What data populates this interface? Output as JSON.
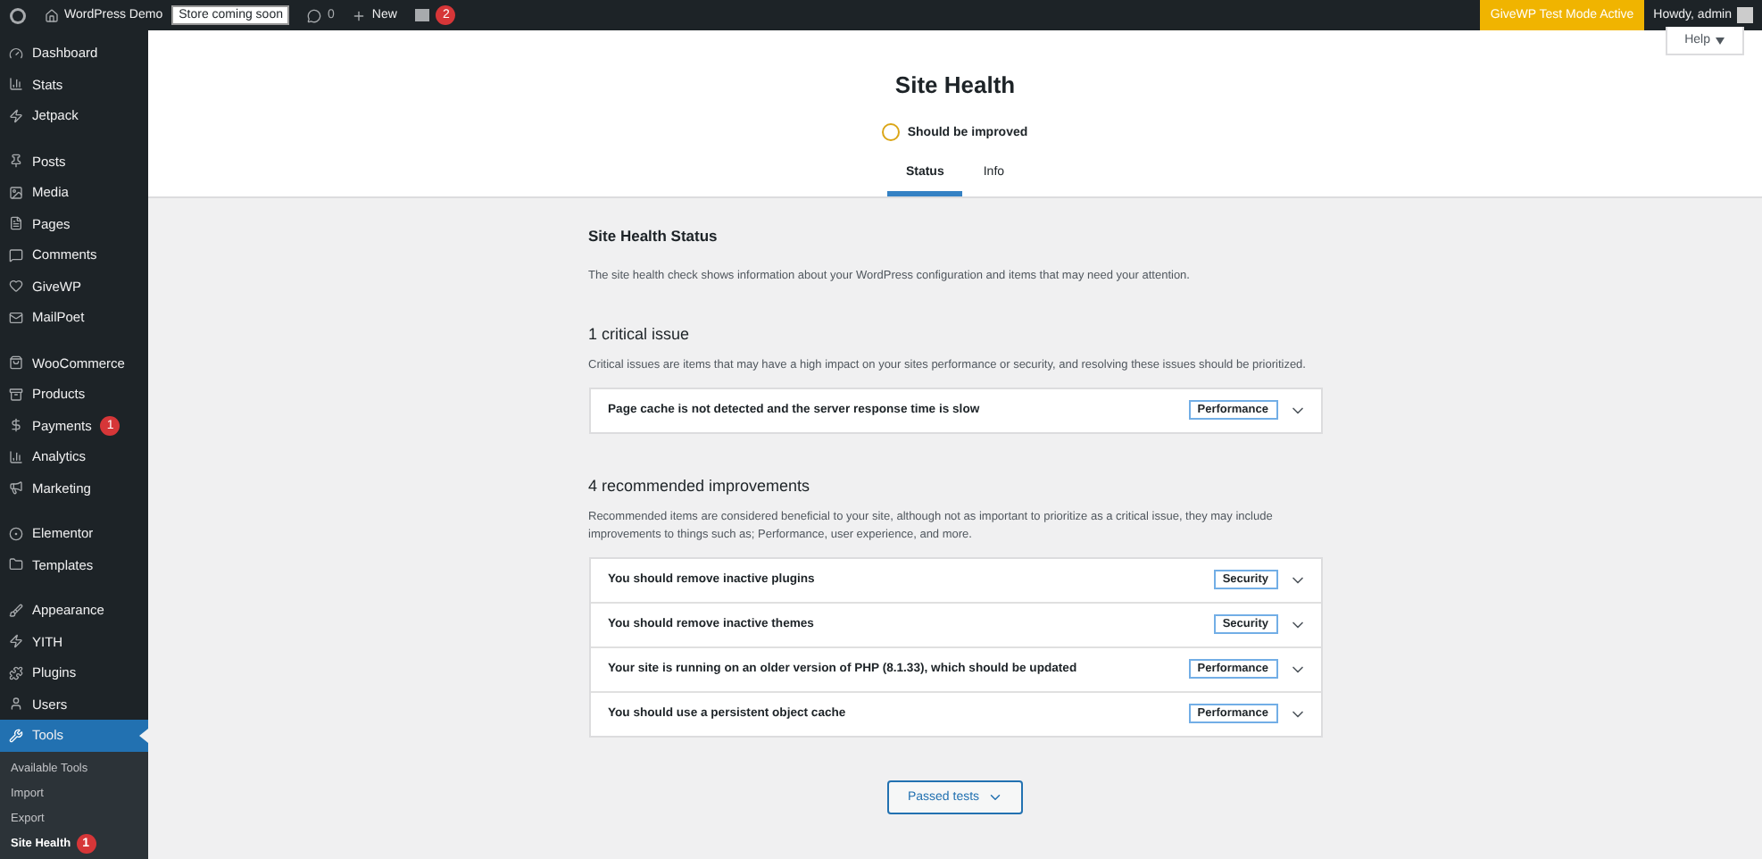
{
  "admin_bar": {
    "site_name": "WordPress Demo",
    "store_badge": "Store coming soon",
    "comments_count": "0",
    "new_label": "New",
    "notifications_count": "2",
    "givewp_notice": "GiveWP Test Mode Active",
    "greeting": "Howdy, admin"
  },
  "sidebar": {
    "groups": [
      {
        "items": [
          {
            "label": "Dashboard",
            "selected": false
          },
          {
            "label": "Stats",
            "selected": false
          },
          {
            "label": "Jetpack",
            "selected": false
          }
        ]
      },
      {
        "items": [
          {
            "label": "Posts",
            "selected": false
          },
          {
            "label": "Media",
            "selected": false
          },
          {
            "label": "Pages",
            "selected": false
          },
          {
            "label": "Comments",
            "selected": false
          },
          {
            "label": "GiveWP",
            "selected": false
          },
          {
            "label": "MailPoet",
            "selected": false
          }
        ]
      },
      {
        "items": [
          {
            "label": "WooCommerce",
            "selected": false
          },
          {
            "label": "Products",
            "selected": false
          },
          {
            "label": "Payments",
            "selected": false,
            "badge": "1"
          },
          {
            "label": "Analytics",
            "selected": false
          },
          {
            "label": "Marketing",
            "selected": false
          }
        ]
      },
      {
        "items": [
          {
            "label": "Elementor",
            "selected": false
          },
          {
            "label": "Templates",
            "selected": false
          }
        ]
      },
      {
        "items": [
          {
            "label": "Appearance",
            "selected": false
          },
          {
            "label": "YITH",
            "selected": false
          },
          {
            "label": "Plugins",
            "selected": false
          },
          {
            "label": "Users",
            "selected": false
          },
          {
            "label": "Tools",
            "selected": true,
            "children": [
              {
                "label": "Available Tools",
                "selected": false
              },
              {
                "label": "Import",
                "selected": false
              },
              {
                "label": "Export",
                "selected": false
              },
              {
                "label": "Site Health",
                "selected": true,
                "badge": "1"
              }
            ]
          }
        ]
      }
    ]
  },
  "help_button": "Help",
  "header": {
    "title": "Site Health",
    "status": "Should be improved",
    "tabs": [
      {
        "label": "Status",
        "selected": true
      },
      {
        "label": "Info",
        "selected": false
      }
    ]
  },
  "status_section": {
    "title": "Site Health Status",
    "description": "The site health check shows information about your WordPress configuration and items that may need your attention."
  },
  "critical": {
    "title": "1 critical issue",
    "description": "Critical issues are items that may have a high impact on your sites performance or security, and resolving these issues should be prioritized.",
    "items": [
      {
        "title": "Page cache is not detected and the server response time is slow",
        "tag": "Performance"
      }
    ]
  },
  "recommended": {
    "title": "4 recommended improvements",
    "description": "Recommended items are considered beneficial to your site, although not as important to prioritize as a critical issue, they may include improvements to things such as; Performance, user experience, and more.",
    "items": [
      {
        "title": "You should remove inactive plugins",
        "tag": "Security"
      },
      {
        "title": "You should remove inactive themes",
        "tag": "Security"
      },
      {
        "title": "Your site is running on an older version of PHP (8.1.33), which should be updated",
        "tag": "Performance"
      },
      {
        "title": "You should use a persistent object cache",
        "tag": "Performance"
      }
    ]
  },
  "passed_tests_button": "Passed tests"
}
